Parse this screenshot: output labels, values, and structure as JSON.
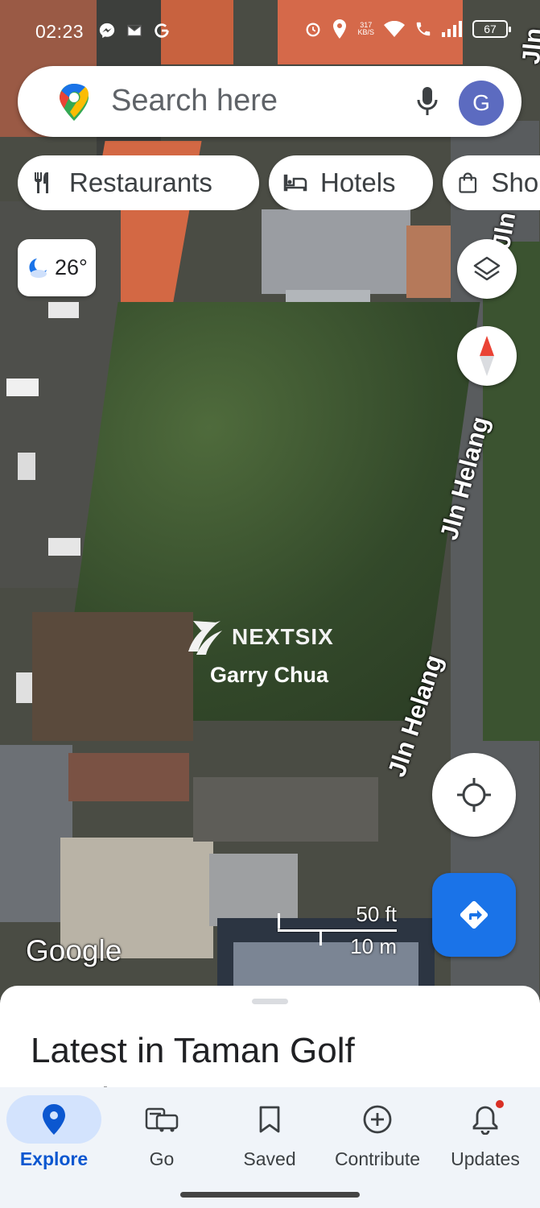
{
  "status_bar": {
    "time": "02:23",
    "left_icons": [
      "messenger-icon",
      "gmail-icon",
      "google-icon"
    ],
    "network_speed_value": "317",
    "network_speed_unit": "KB/S",
    "battery_level": "67"
  },
  "search": {
    "placeholder": "Search here",
    "avatar_letter": "G"
  },
  "chips": [
    {
      "label": "Restaurants",
      "icon": "fork-knife-icon"
    },
    {
      "label": "Hotels",
      "icon": "bed-icon"
    },
    {
      "label": "Shopping",
      "icon": "shopping-bag-icon"
    }
  ],
  "weather": {
    "temperature": "26°",
    "icon": "moon-cloud-icon"
  },
  "map": {
    "street_labels": [
      "Jln Helang",
      "Jln Helang",
      "Jln He",
      "Jln"
    ],
    "watermark_brand": "NEXTSIX",
    "watermark_name": "Garry Chua",
    "attribution": "Google",
    "scale_ft": "50 ft",
    "scale_m": "10 m"
  },
  "sheet": {
    "title": "Latest in Taman Golf Garden"
  },
  "bottom_nav": [
    {
      "label": "Explore",
      "icon": "explore-pin-icon",
      "active": true
    },
    {
      "label": "Go",
      "icon": "car-icon",
      "active": false
    },
    {
      "label": "Saved",
      "icon": "bookmark-icon",
      "active": false
    },
    {
      "label": "Contribute",
      "icon": "add-circle-icon",
      "active": false
    },
    {
      "label": "Updates",
      "icon": "bell-icon",
      "active": false,
      "badge": true
    }
  ],
  "colors": {
    "accent": "#1a73e8",
    "active_nav_bg": "#d3e3fd",
    "active_nav_text": "#0b57d0",
    "badge": "#d93025"
  }
}
